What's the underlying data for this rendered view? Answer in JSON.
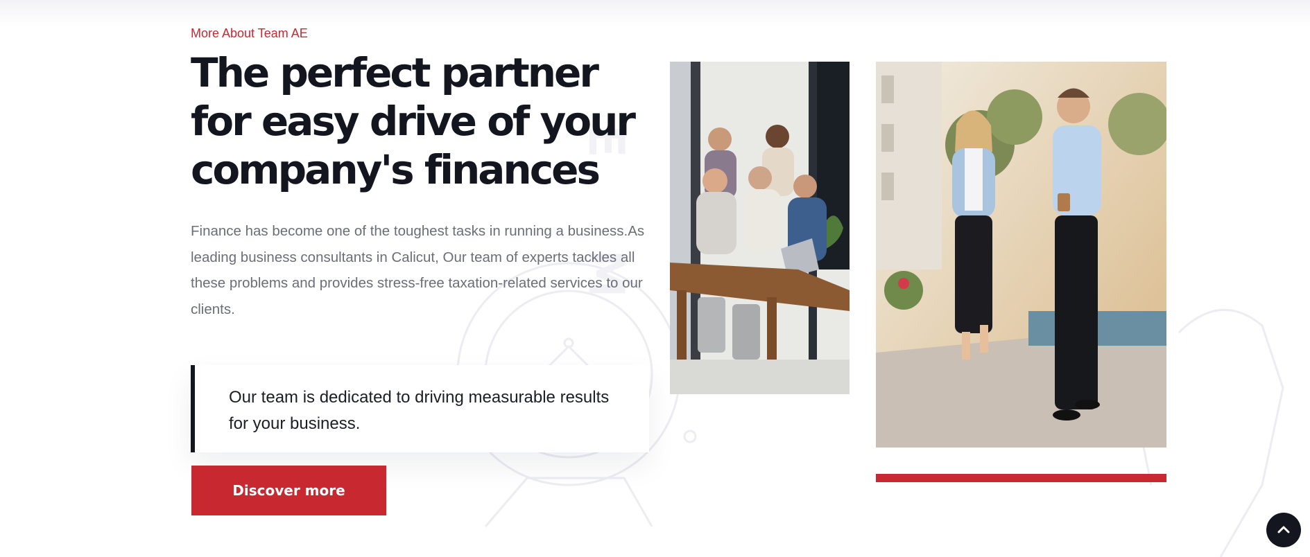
{
  "section": {
    "eyebrow": "More About Team AE",
    "headline": "The perfect partner for easy drive of your company's finances",
    "body": "Finance has become one of the toughest tasks in running a business.As leading business consultants in Calicut, Our team of experts tackles all these problems and provides stress-free taxation-related services to our clients.",
    "quote": "Our team is dedicated to driving measurable results for your business.",
    "cta_label": "Discover more"
  },
  "colors": {
    "accent": "#c8282f",
    "dark": "#13151f",
    "body_text": "#6b6e77"
  },
  "icons": {
    "scroll_top": "chevron-up-icon"
  }
}
